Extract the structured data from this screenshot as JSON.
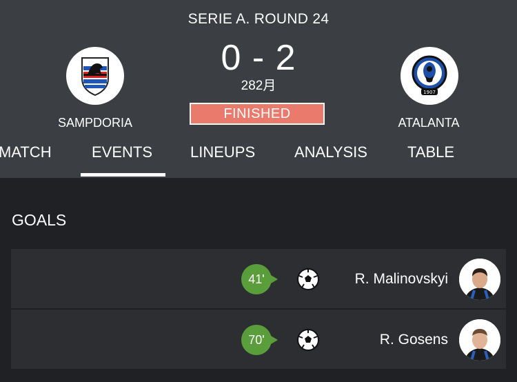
{
  "match": {
    "round_title": "SERIE A. ROUND 24",
    "score": "0 - 2",
    "date": "282月",
    "status": "FINISHED"
  },
  "home_team": {
    "name": "SAMPDORIA",
    "logo": "sampdoria-crest-icon"
  },
  "away_team": {
    "name": "ATALANTA",
    "logo": "atalanta-crest-icon"
  },
  "tabs": [
    {
      "label": "MATCH"
    },
    {
      "label": "EVENTS",
      "active": true
    },
    {
      "label": "LINEUPS"
    },
    {
      "label": "ANALYSIS"
    },
    {
      "label": "TABLE"
    }
  ],
  "events": {
    "section_title": "GOALS",
    "goals": [
      {
        "minute": "41'",
        "player": "R. Malinovskyi",
        "icon": "soccer-ball-icon"
      },
      {
        "minute": "70'",
        "player": "R. Gosens",
        "icon": "soccer-ball-icon"
      }
    ]
  },
  "colors": {
    "header_bg": "#3b3e42",
    "page_bg": "#1f2124",
    "row_bg": "#2c2e32",
    "status_badge": "#ea7b6c",
    "minute_badge": "#5a9e3b"
  }
}
